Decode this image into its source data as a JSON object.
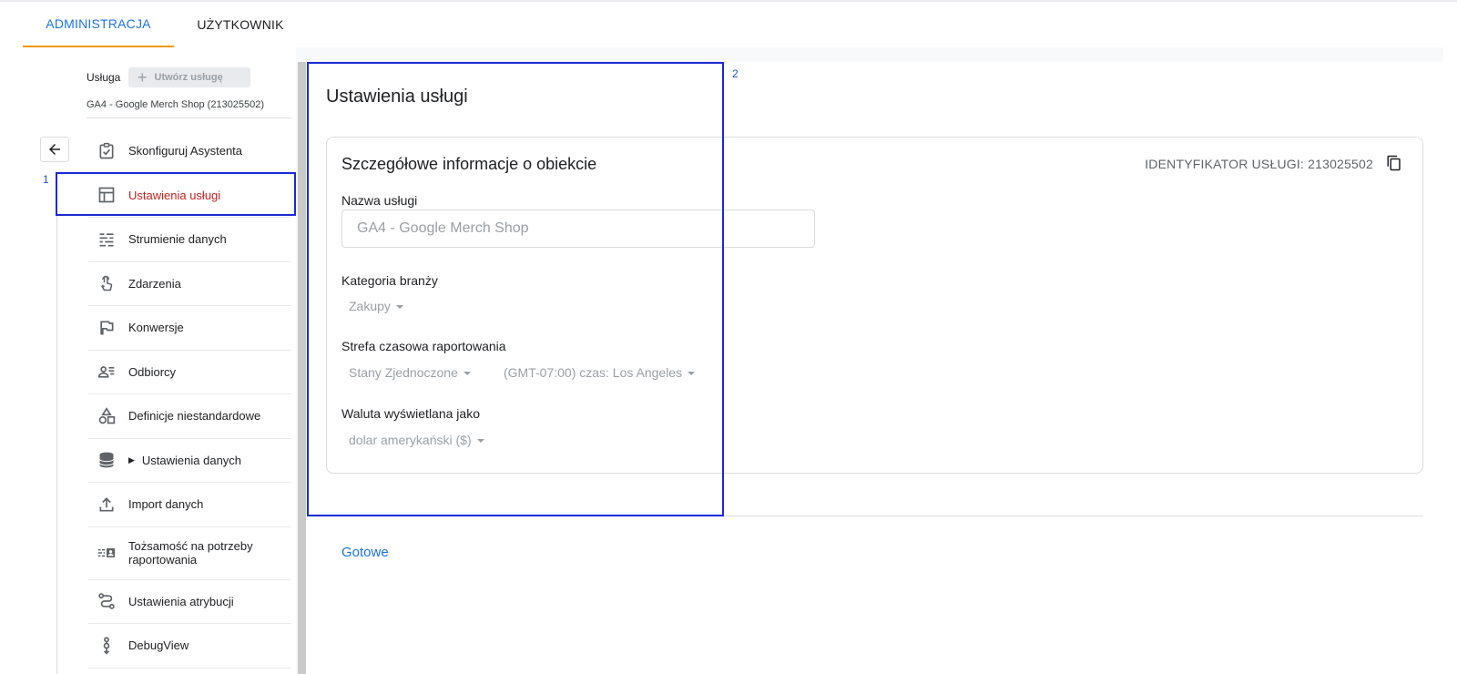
{
  "tabs": [
    {
      "label": "ADMINISTRACJA",
      "active": true
    },
    {
      "label": "UŻYTKOWNIK",
      "active": false
    }
  ],
  "property": {
    "label": "Usługa",
    "create_button": "Utwórz usługę",
    "selected": "GA4 - Google Merch Shop (213025502)"
  },
  "nav": {
    "items": [
      {
        "label": "Skonfiguruj Asystenta",
        "icon": "checklist-icon"
      },
      {
        "label": "Ustawienia usługi",
        "icon": "layout-icon",
        "active": true
      },
      {
        "label": "Strumienie danych",
        "icon": "data-streams-icon"
      },
      {
        "label": "Zdarzenia",
        "icon": "touch-icon"
      },
      {
        "label": "Konwersje",
        "icon": "flag-icon"
      },
      {
        "label": "Odbiorcy",
        "icon": "audience-icon"
      },
      {
        "label": "Definicje niestandardowe",
        "icon": "shapes-icon"
      },
      {
        "label": "Ustawienia danych",
        "icon": "database-icon",
        "expandable": true
      },
      {
        "label": "Import danych",
        "icon": "upload-icon"
      },
      {
        "label": "Tożsamość na potrzeby raportowania",
        "icon": "identity-icon"
      },
      {
        "label": "Ustawienia atrybucji",
        "icon": "attribution-icon"
      },
      {
        "label": "DebugView",
        "icon": "debug-icon"
      }
    ]
  },
  "annotations": {
    "box1": "1",
    "box2": "2"
  },
  "main": {
    "page_title": "Ustawienia usługi",
    "card_title": "Szczegółowe informacje o obiekcie",
    "property_id": "IDENTYFIKATOR USŁUGI: 213025502",
    "name_label": "Nazwa usługi",
    "name_value": "GA4 - Google Merch Shop",
    "industry_label": "Kategoria branży",
    "industry_value": "Zakupy",
    "timezone_label": "Strefa czasowa raportowania",
    "country_value": "Stany Zjednoczone",
    "timezone_value": "(GMT-07:00) czas: Los Angeles",
    "currency_label": "Waluta wyświetlana jako",
    "currency_value": "dolar amerykański ($)",
    "done_button": "Gotowe"
  },
  "colors": {
    "accent": "#1a73e8",
    "active_tab_underline": "#f29900",
    "active_nav": "#c5221f",
    "annotation": "#1a2ad4"
  }
}
